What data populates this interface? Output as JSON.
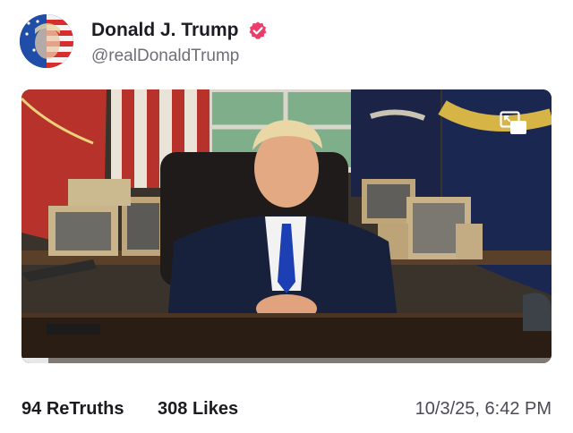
{
  "post": {
    "author": {
      "display_name": "Donald J. Trump",
      "handle": "@realDonaldTrump",
      "verified": true,
      "verified_color": "#ec3e6a"
    },
    "media": {
      "type": "video",
      "progress_fraction": 0.05,
      "controls": [
        "picture-in-picture-icon"
      ]
    },
    "stats": {
      "retruths_count": "94",
      "retruths_label": "ReTruths",
      "likes_count": "308",
      "likes_label": "Likes"
    },
    "timestamp": "10/3/25, 6:42 PM"
  }
}
